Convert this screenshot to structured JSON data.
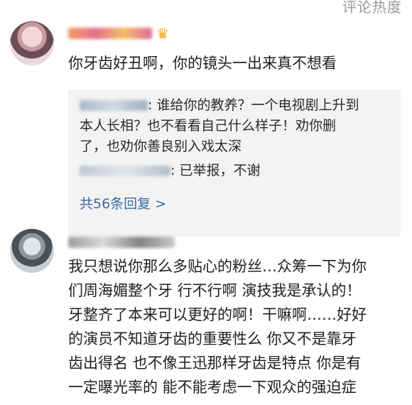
{
  "top_fragment": "评论热度",
  "comments": [
    {
      "username": "",
      "text": "你牙齿好丑啊，你的镜头一出来真不想看",
      "replies": [
        {
          "text_lines": [
            ": 谁给你的教养？一个电视剧上升到",
            "本人长相？也不看看自己什么样子！劝你删",
            "了，也劝你善良别入戏太深"
          ]
        },
        {
          "text": ": 已举报，不谢"
        }
      ],
      "more_replies": "共56条回复 >"
    },
    {
      "username": "",
      "text_lines": [
        "我只想说你那么多贴心的粉丝…众筹一下为你",
        "们周海媚整个牙 行不行啊 演技我是承认的！",
        "牙整齐了本来可以更好的啊！干嘛啊……好好",
        "的演员不知道牙齿的重要性么 你又不是靠牙",
        "齿出得名 也不像王迅那样牙齿是特点 你是有",
        "一定曝光率的 能不能考虑一下观众的强迫症"
      ]
    }
  ]
}
